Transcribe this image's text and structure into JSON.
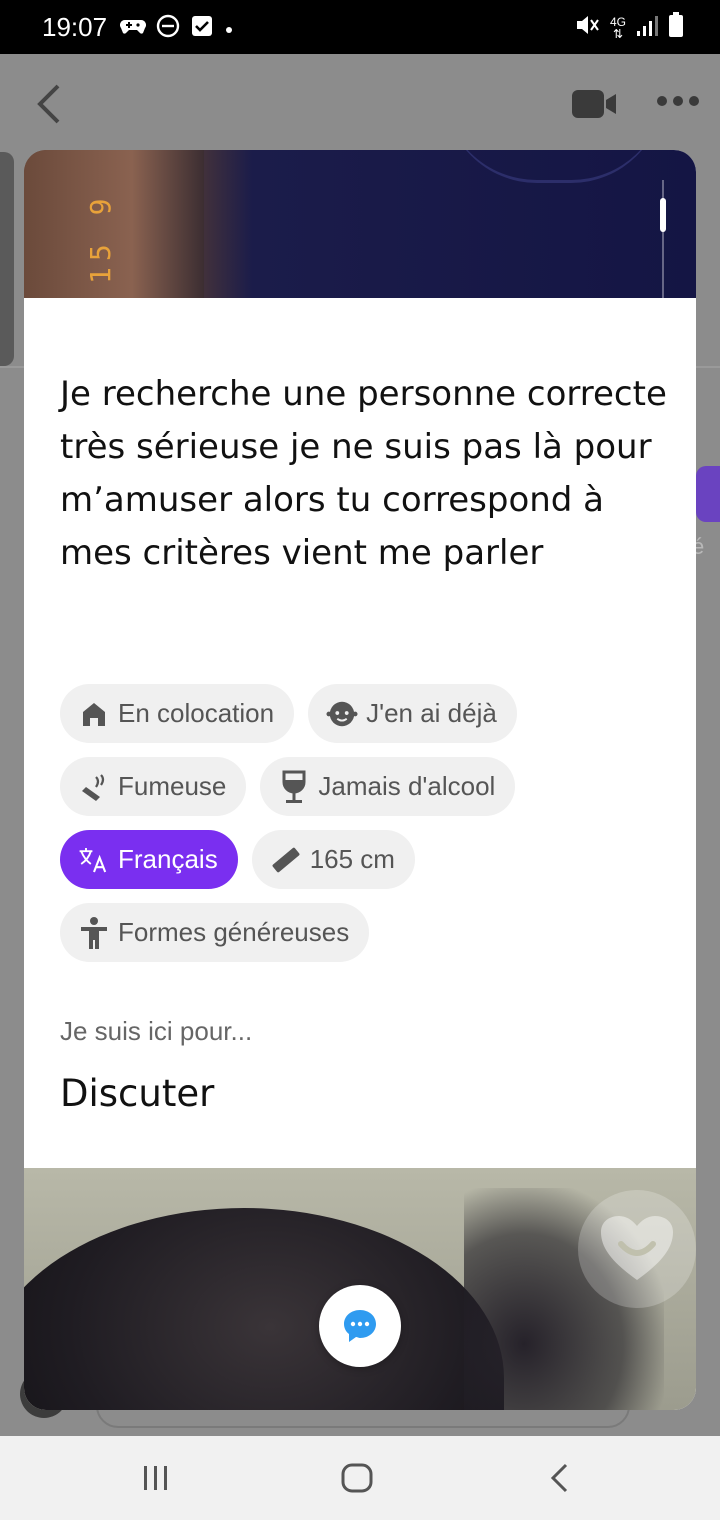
{
  "status_bar": {
    "time": "19:07",
    "network_label": "4G",
    "icons_left": [
      "game-controller-icon",
      "do-not-disturb-icon",
      "checkbox-icon",
      "dot-icon"
    ],
    "icons_right": [
      "mute-icon",
      "4g-icon",
      "signal-icon",
      "battery-icon"
    ]
  },
  "header": {
    "back_icon": "chevron-left-icon",
    "video_icon": "video-camera-icon",
    "more_icon": "more-dots-icon"
  },
  "photo_top": {
    "numbers_text": "15 9"
  },
  "profile": {
    "bio": "Je recherche une personne correcte très sérieuse je ne suis pas là pour m’amuser alors tu correspond à mes critères vient me parler",
    "chips": [
      [
        {
          "icon": "house-icon",
          "label": "En colocation",
          "active": false
        },
        {
          "icon": "baby-face-icon",
          "label": "J'en ai déjà",
          "active": false
        }
      ],
      [
        {
          "icon": "cigarette-icon",
          "label": "Fumeuse",
          "active": false
        },
        {
          "icon": "wine-glass-icon",
          "label": "Jamais d'alcool",
          "active": false
        }
      ],
      [
        {
          "icon": "translate-icon",
          "label": "Français",
          "active": true
        },
        {
          "icon": "ruler-icon",
          "label": "165 cm",
          "active": false
        }
      ],
      [
        {
          "icon": "person-icon",
          "label": "Formes généreuses",
          "active": false
        }
      ]
    ],
    "purpose_label": "Je suis ici pour...",
    "purpose_value": "Discuter"
  },
  "colors": {
    "accent_purple": "#7a2ff0",
    "chip_bg": "#f0f0f0",
    "chat_blue": "#2f9bf0"
  },
  "behind_app": {
    "right_edge_text": "é"
  },
  "nav_bar": {
    "recents_icon": "recents-icon",
    "home_icon": "home-icon",
    "back_icon": "back-icon"
  }
}
